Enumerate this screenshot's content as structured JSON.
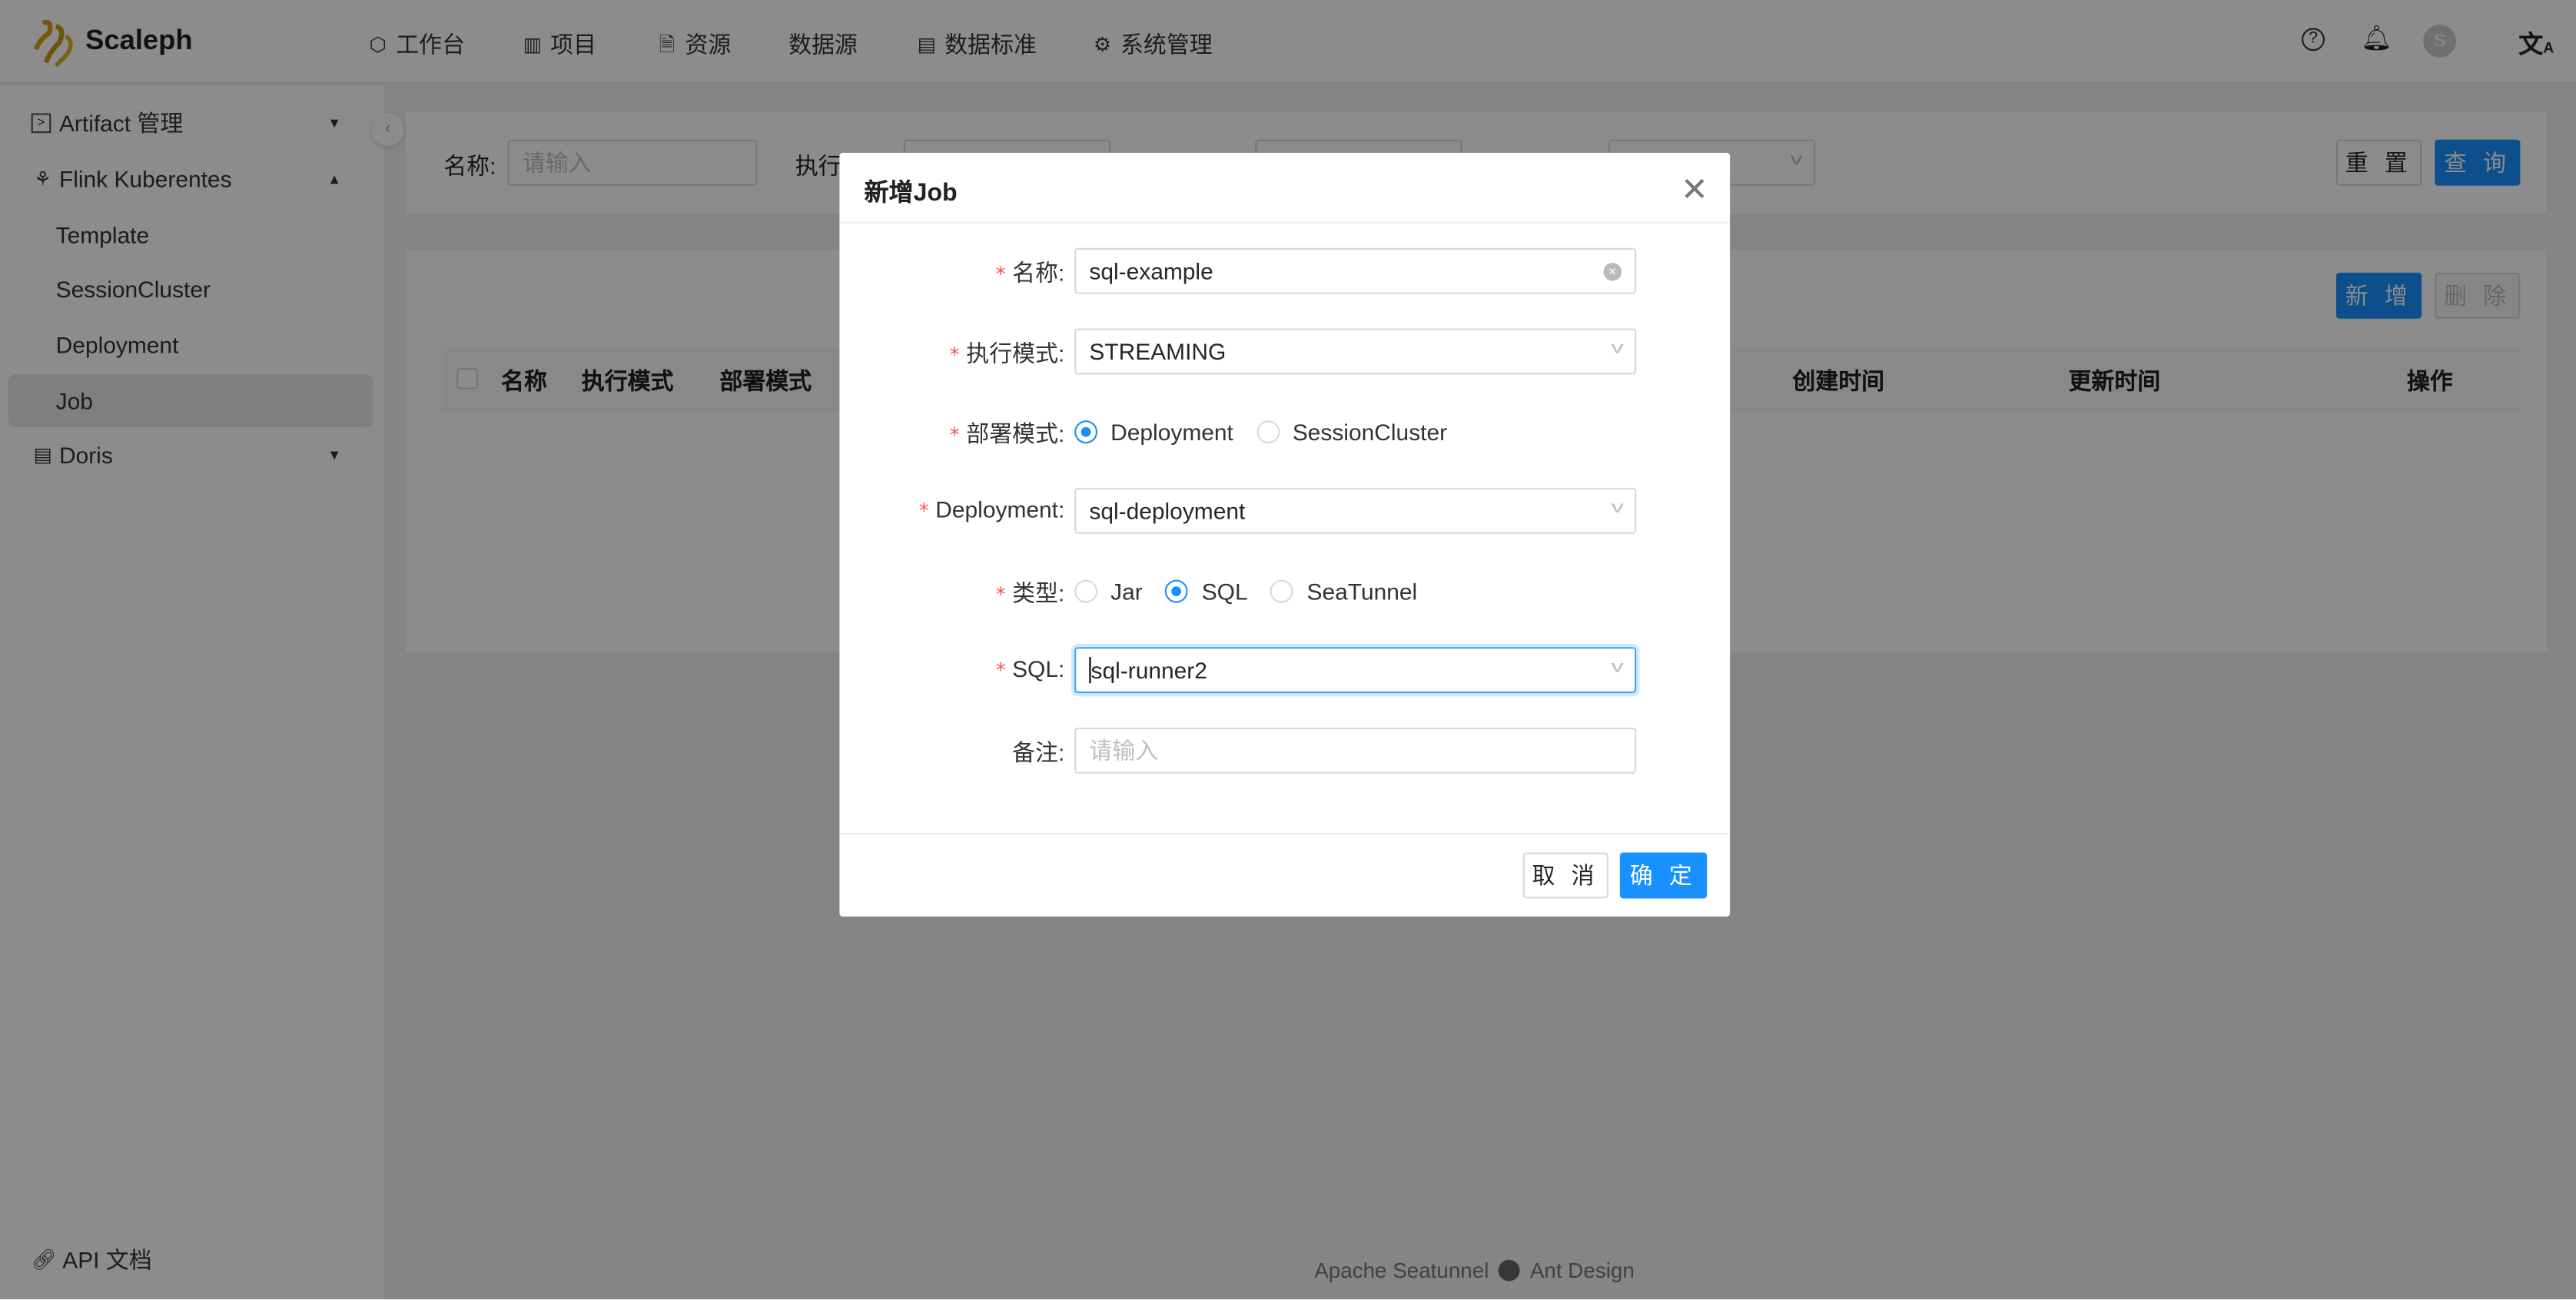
{
  "header": {
    "brand": "Scaleph",
    "nav": [
      {
        "label": "工作台",
        "icon": "cube-icon"
      },
      {
        "label": "项目",
        "icon": "project-icon"
      },
      {
        "label": "资源",
        "icon": "file-icon"
      },
      {
        "label": "数据源",
        "icon": ""
      },
      {
        "label": "数据标准",
        "icon": "database-icon"
      },
      {
        "label": "系统管理",
        "icon": "gear-icon"
      }
    ],
    "avatar": "S"
  },
  "sidebar": {
    "items": [
      {
        "label": "Artifact 管理",
        "icon": "terminal-icon",
        "expanded": false
      },
      {
        "label": "Flink Kuberentes",
        "icon": "cluster-icon",
        "expanded": true
      },
      {
        "label": "Template"
      },
      {
        "label": "SessionCluster"
      },
      {
        "label": "Deployment"
      },
      {
        "label": "Job",
        "selected": true
      },
      {
        "label": "Doris",
        "icon": "doris-icon",
        "expanded": false
      }
    ],
    "api_docs": "API 文档"
  },
  "search": {
    "name_label": "名称:",
    "name_placeholder": "请输入",
    "mode_label": "执行",
    "reset": "重 置",
    "query": "查 询"
  },
  "table": {
    "add": "新 增",
    "delete": "删 除",
    "columns": [
      "名称",
      "执行模式",
      "部署模式",
      "创建时间",
      "更新时间",
      "操作"
    ]
  },
  "footer": {
    "left": "Apache Seatunnel",
    "right": "Ant Design"
  },
  "modal": {
    "title": "新增Job",
    "fields": {
      "name": {
        "label": "名称:",
        "value": "sql-example"
      },
      "mode": {
        "label": "执行模式:",
        "value": "STREAMING"
      },
      "deploy_mode": {
        "label": "部署模式:",
        "options": [
          "Deployment",
          "SessionCluster"
        ],
        "selected": "Deployment"
      },
      "deployment": {
        "label": "Deployment:",
        "value": "sql-deployment"
      },
      "type": {
        "label": "类型:",
        "options": [
          "Jar",
          "SQL",
          "SeaTunnel"
        ],
        "selected": "SQL"
      },
      "sql": {
        "label": "SQL:",
        "value": "sql-runner2"
      },
      "remark": {
        "label": "备注:",
        "placeholder": "请输入"
      }
    },
    "cancel": "取 消",
    "ok": "确 定"
  },
  "colors": {
    "primary": "#1890ff",
    "required": "#ff4d4f",
    "brand": "#d4a017"
  }
}
